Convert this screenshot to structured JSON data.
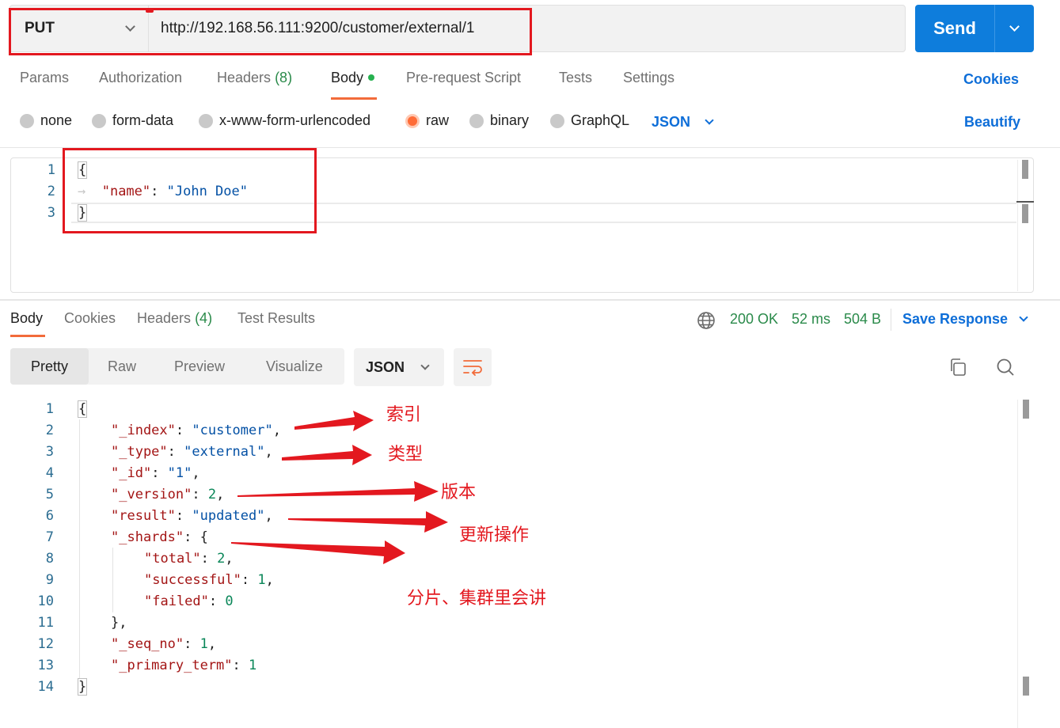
{
  "request": {
    "method": "PUT",
    "url": "http://192.168.56.111:9200/customer/external/1",
    "send_label": "Send"
  },
  "request_tabs": [
    {
      "label": "Params"
    },
    {
      "label": "Authorization"
    },
    {
      "label": "Headers",
      "count": "(8)"
    },
    {
      "label": "Body"
    },
    {
      "label": "Pre-request Script"
    },
    {
      "label": "Tests"
    },
    {
      "label": "Settings"
    }
  ],
  "cookies_label": "Cookies",
  "body_types": [
    "none",
    "form-data",
    "x-www-form-urlencoded",
    "raw",
    "binary",
    "GraphQL"
  ],
  "body_type_selected": "raw",
  "body_language": "JSON",
  "beautify_label": "Beautify",
  "request_body": {
    "line_numbers": [
      "1",
      "2",
      "3"
    ],
    "open_brace": "{",
    "key": "\"name\"",
    "colon": ":",
    "value": "\"John Doe\"",
    "close_brace": "}"
  },
  "response_tabs": [
    {
      "label": "Body"
    },
    {
      "label": "Cookies"
    },
    {
      "label": "Headers",
      "count": "(4)"
    },
    {
      "label": "Test Results"
    }
  ],
  "response_status": {
    "code": "200 OK",
    "time": "52 ms",
    "size": "504 B"
  },
  "save_response_label": "Save Response",
  "view_modes": [
    "Pretty",
    "Raw",
    "Preview",
    "Visualize"
  ],
  "response_format": "JSON",
  "response_body": {
    "line_numbers": [
      "1",
      "2",
      "3",
      "4",
      "5",
      "6",
      "7",
      "8",
      "9",
      "10",
      "11",
      "12",
      "13",
      "14"
    ],
    "lines": [
      {
        "k": "",
        "v": "",
        "p": "{"
      },
      {
        "k": "\"_index\"",
        "v": "\"customer\"",
        "p": ","
      },
      {
        "k": "\"_type\"",
        "v": "\"external\"",
        "p": ","
      },
      {
        "k": "\"_id\"",
        "v": "\"1\"",
        "p": ","
      },
      {
        "k": "\"_version\"",
        "v": "2",
        "p": ","
      },
      {
        "k": "\"result\"",
        "v": "\"updated\"",
        "p": ","
      },
      {
        "k": "\"_shards\"",
        "v": "",
        "p": "{"
      },
      {
        "k": "\"total\"",
        "v": "2",
        "p": ","
      },
      {
        "k": "\"successful\"",
        "v": "1",
        "p": ","
      },
      {
        "k": "\"failed\"",
        "v": "0",
        "p": ""
      },
      {
        "k": "",
        "v": "",
        "p": "},"
      },
      {
        "k": "\"_seq_no\"",
        "v": "1",
        "p": ","
      },
      {
        "k": "\"_primary_term\"",
        "v": "1",
        "p": ""
      },
      {
        "k": "",
        "v": "",
        "p": "}"
      }
    ]
  },
  "annotations": {
    "index": "索引",
    "type": "类型",
    "version": "版本",
    "result": "更新操作",
    "shards": "分片、集群里会讲"
  },
  "colors": {
    "accent_orange": "#ff6c37",
    "primary_blue": "#0e7ddc",
    "status_green": "#2a8a4a",
    "annotation_red": "#e3181f"
  }
}
